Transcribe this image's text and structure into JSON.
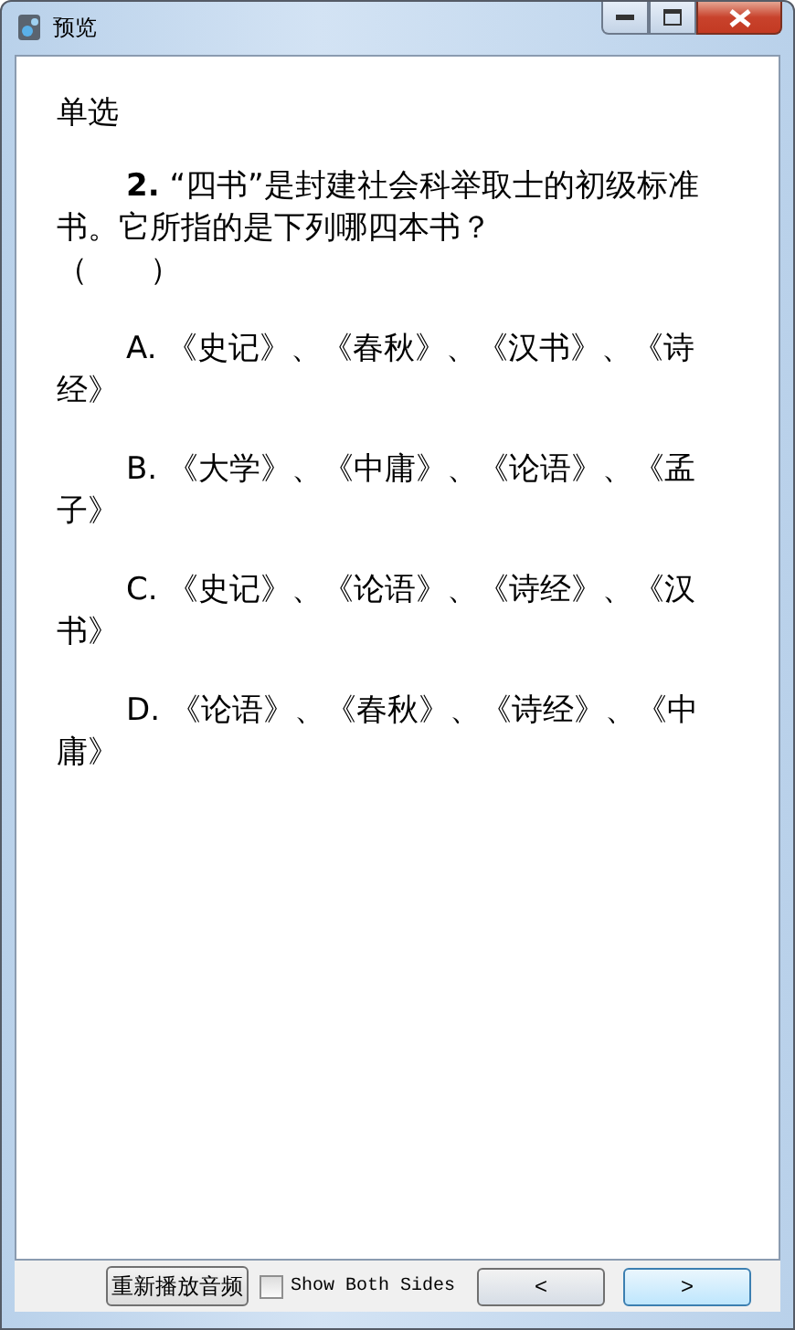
{
  "window": {
    "title": "预览"
  },
  "question": {
    "type_label": "单选",
    "number": "2.",
    "text": "“四书”是封建社会科举取士的初级标准书。它所指的是下列哪四本书？",
    "blank": "（　　）"
  },
  "options": [
    {
      "letter": "A.",
      "text": "《史记》、《春秋》、《汉书》、《诗经》"
    },
    {
      "letter": "B.",
      "text": "《大学》、《中庸》、《论语》、《孟子》"
    },
    {
      "letter": "C.",
      "text": "《史记》、《论语》、《诗经》、《汉书》"
    },
    {
      "letter": "D.",
      "text": "《论语》、《春秋》、《诗经》、《中庸》"
    }
  ],
  "bottom_bar": {
    "replay_button": "重新播放音频",
    "show_both_sides": {
      "label": "Show Both Sides",
      "checked": false
    },
    "prev_button": "<",
    "next_button": ">"
  }
}
